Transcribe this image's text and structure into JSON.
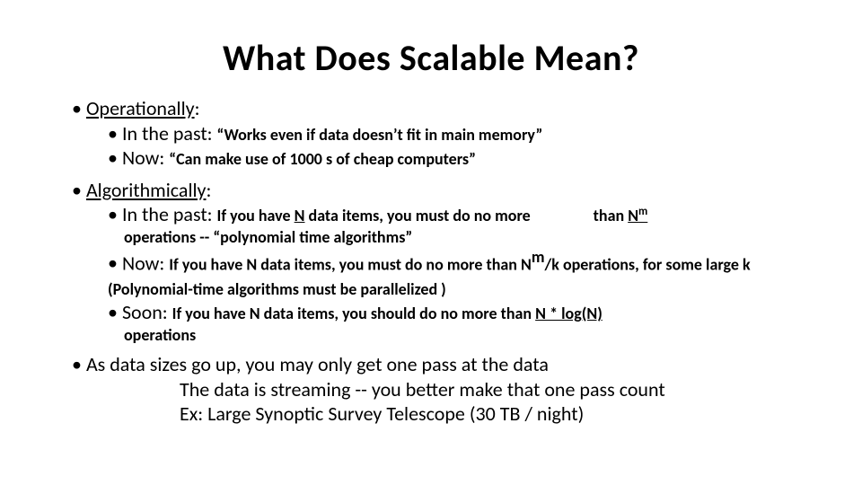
{
  "slide": {
    "title": "What Does Scalable Mean?",
    "op": {
      "heading": "Operationally",
      "past_lead": "In the past: ",
      "past_body": "“Works even if data doesn’t fit in main memory”",
      "now_lead": "Now: ",
      "now_body": "“Can make use of 1000 s of cheap computers”"
    },
    "alg": {
      "heading": "Algorithmically",
      "past_lead": "In the past: ",
      "past_a": "If you have ",
      "past_N": "N",
      "past_b": " data items, you must do no more",
      "past_than": "than ",
      "past_Nm_N": "N",
      "past_Nm_m": "m",
      "past_line2": "operations -- “polynomial time algorithms”",
      "now_lead": "Now: ",
      "now_a": "If you have N data items, you must do no more than N",
      "now_m": "m",
      "now_b": "/k operations, for some large k (",
      "now_c": "Polynomial-time algorithms must be parallelized )",
      "soon_lead": "Soon: ",
      "soon_a": "If you have N data items, you should do no more than ",
      "soon_expr": "N * log(N)",
      "soon_line2": "operations"
    },
    "closing": {
      "l1": "As data sizes go up, you may only get one pass at the data",
      "l2": "The data is streaming -- you better make that one pass count",
      "l3": "Ex: Large Synoptic Survey Telescope (30 TB / night)"
    }
  }
}
